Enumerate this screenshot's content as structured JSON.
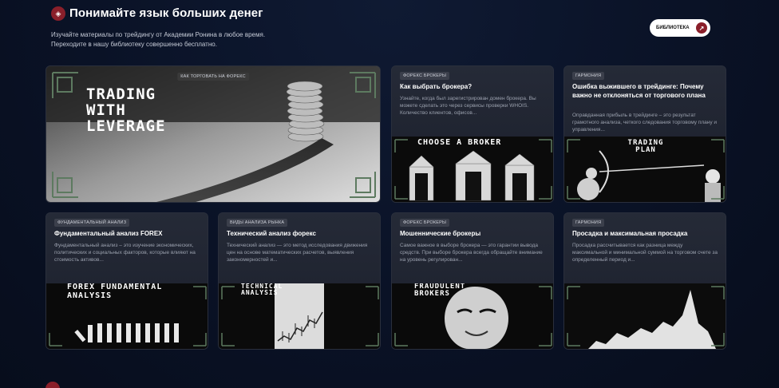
{
  "header": {
    "title": "Понимайте язык больших денег",
    "subtitle_line1": "Изучайте материалы по трейдингу от Академии Ронина в любое время.",
    "subtitle_line2": "Переходите в нашу библиотеку совершенно бесплатно.",
    "library_button": "БИБЛИОТЕКА"
  },
  "featured": {
    "tag": "КАК ТОРГОВАТЬ НА ФОРЕКС",
    "image_text": [
      "TRADING",
      "WITH",
      "LEVERAGE"
    ]
  },
  "cards": [
    {
      "tag": "ФОРЕКС БРОКЕРЫ",
      "title": "Как выбрать брокера?",
      "description": "Узнайте, когда был зарегистрирован домен брокера. Вы можете сделать это через сервисы проверки WHOIS. Количество клиентов, офисов...",
      "image_text": "CHOOSE A BROKER"
    },
    {
      "tag": "ГАРМОНИЯ",
      "title": "Ошибка выжившего в трейдинге: Почему важно не отклоняться от торгового плана",
      "description": "Оправданная прибыль в трейдинге – это результат грамотного анализа, четкого следования торговому плану и управления...",
      "image_text": "TRADING PLAN"
    },
    {
      "tag": "ФУНДАМЕНТАЛЬНЫЙ АНАЛИЗ",
      "title": "Фундаментальный анализ FOREX",
      "description": "Фундаментальный анализ – это изучение экономических, политических и социальных факторов, которые влияют на стоимость активов...",
      "image_text": "FOREX FUNDAMENTAL ANALYSIS"
    },
    {
      "tag": "ВИДЫ АНАЛИЗА РЫНКА",
      "title": "Технический анализ форекс",
      "description": "Технический анализ — это метод исследования движения цен на основе математических расчетов, выявления закономерностей и...",
      "image_text": "TECHNICAL ANALYSIS"
    },
    {
      "tag": "ФОРЕКС БРОКЕРЫ",
      "title": "Мошеннические брокеры",
      "description": "Самое важное в выборе брокера — это гарантии вывода средств. При выборе брокера всегда обращайте внимание на уровень регулирован...",
      "image_text": "FRAUDULENT BROKERS"
    },
    {
      "tag": "ГАРМОНИЯ",
      "title": "Просадка и максимальная просадка",
      "description": "Просадка рассчитывается как разница между максимальной и минимальной суммой на торговом счете за определенный период и...",
      "image_text": ""
    }
  ],
  "colors": {
    "accent": "#8a1f2a",
    "background": "#0a1226",
    "card": "#1f2330"
  }
}
